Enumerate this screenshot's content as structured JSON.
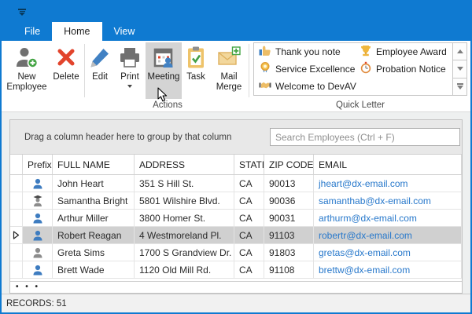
{
  "colors": {
    "accent": "#0f7ad1",
    "selection": "#d0d0d0",
    "link": "#2778cb"
  },
  "ribbon": {
    "tabs": [
      {
        "label": "File"
      },
      {
        "label": "Home"
      },
      {
        "label": "View"
      }
    ],
    "active_tab": "Home",
    "buttons": {
      "new_employee": "New Employee",
      "delete": "Delete",
      "edit": "Edit",
      "print": "Print",
      "meeting": "Meeting",
      "task": "Task",
      "mail_merge": "Mail Merge"
    },
    "groups": {
      "actions": "Actions",
      "quick_letter": "Quick Letter"
    },
    "quick_letter_items": [
      {
        "label": "Thank you note",
        "icon": "thumbs-up-icon"
      },
      {
        "label": "Employee Award",
        "icon": "trophy-icon"
      },
      {
        "label": "Service Excellence",
        "icon": "medal-icon"
      },
      {
        "label": "Probation Notice",
        "icon": "stopwatch-icon"
      },
      {
        "label": "Welcome to DevAV",
        "icon": "handshake-icon"
      }
    ]
  },
  "grid": {
    "group_panel_text": "Drag a column header here to group by that column",
    "search_placeholder": "Search Employees (Ctrl + F)",
    "columns": {
      "prefix": "Prefix",
      "full_name": "FULL NAME",
      "address": "ADDRESS",
      "state": "STATE",
      "zip": "ZIP CODE",
      "email": "EMAIL"
    },
    "rows": [
      {
        "prefix_icon": "person-blue-icon",
        "full_name": "John Heart",
        "address": "351 S Hill St.",
        "state": "CA",
        "zip": "90013",
        "email": "jheart@dx-email.com",
        "selected": false
      },
      {
        "prefix_icon": "person-graduate-icon",
        "full_name": "Samantha Bright",
        "address": "5801 Wilshire Blvd.",
        "state": "CA",
        "zip": "90036",
        "email": "samanthab@dx-email.com",
        "selected": false
      },
      {
        "prefix_icon": "person-blue-icon",
        "full_name": "Arthur Miller",
        "address": "3800 Homer St.",
        "state": "CA",
        "zip": "90031",
        "email": "arthurm@dx-email.com",
        "selected": false
      },
      {
        "prefix_icon": "person-blue-icon",
        "full_name": "Robert Reagan",
        "address": "4 Westmoreland Pl.",
        "state": "CA",
        "zip": "91103",
        "email": "robertr@dx-email.com",
        "selected": true
      },
      {
        "prefix_icon": "person-gray-icon",
        "full_name": "Greta Sims",
        "address": "1700 S Grandview Dr.",
        "state": "CA",
        "zip": "91803",
        "email": "gretas@dx-email.com",
        "selected": false
      },
      {
        "prefix_icon": "person-blue-icon",
        "full_name": "Brett Wade",
        "address": "1120 Old Mill Rd.",
        "state": "CA",
        "zip": "91108",
        "email": "brettw@dx-email.com",
        "selected": false
      }
    ],
    "footer_dots": "• • •"
  },
  "statusbar": {
    "records": "RECORDS: 51"
  }
}
